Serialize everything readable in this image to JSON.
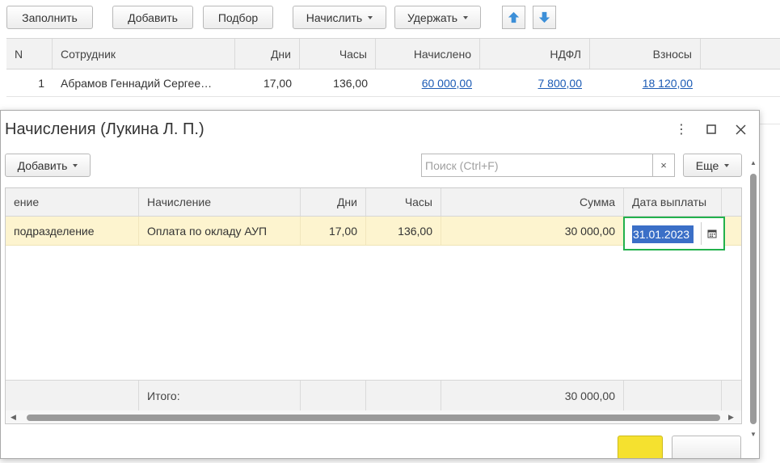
{
  "toolbar": {
    "fill_label": "Заполнить",
    "add_label": "Добавить",
    "pick_label": "Подбор",
    "accrue_label": "Начислить",
    "withhold_label": "Удержать",
    "up_icon": "arrow-up-icon",
    "down_icon": "arrow-down-icon"
  },
  "main_table": {
    "columns": [
      "N",
      "Сотрудник",
      "Дни",
      "Часы",
      "Начислено",
      "НДФЛ",
      "Взносы"
    ],
    "rows": [
      {
        "n": "1",
        "employee": "Абрамов Геннадий Сергее…",
        "days": "17,00",
        "hours": "136,00",
        "accrued": "60 000,00",
        "ndfl": "7 800,00",
        "contrib": "18 120,00"
      }
    ]
  },
  "dialog": {
    "title": "Начисления (Лукина Л. П.)",
    "add_label": "Добавить",
    "search_placeholder": "Поиск (Ctrl+F)",
    "clear_label": "×",
    "more_label": "Еще",
    "columns": {
      "division": "ение",
      "accrual": "Начисление",
      "days": "Дни",
      "hours": "Часы",
      "sum": "Сумма",
      "pay_date": "Дата выплаты"
    },
    "row": {
      "division": "подразделение",
      "accrual": "Оплата по окладу АУП",
      "days": "17,00",
      "hours": "136,00",
      "sum": "30 000,00",
      "pay_date": "31.01.2023"
    },
    "footer": {
      "total_label": "Итого:",
      "total_sum": "30 000,00"
    }
  },
  "colors": {
    "selected_row": "#fdf4cf",
    "link": "#1c5bb5",
    "highlight_border": "#22b14c",
    "ok_button": "#f5e12f",
    "arrow_blue": "#3c8fd8"
  }
}
